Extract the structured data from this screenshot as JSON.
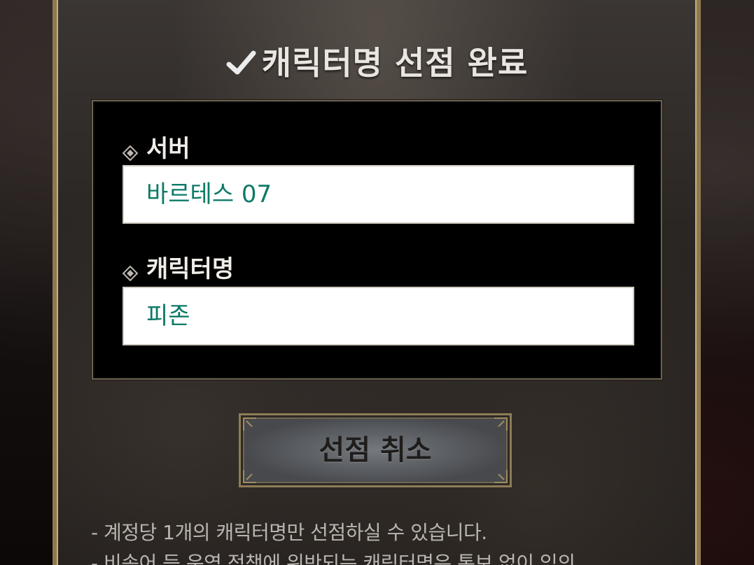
{
  "dialog": {
    "title": "캐릭터명 선점 완료",
    "title_icon": "check-icon"
  },
  "fields": {
    "server": {
      "label": "서버",
      "value": "바르테스 07"
    },
    "character": {
      "label": "캐릭터명",
      "value": "피존"
    }
  },
  "actions": {
    "cancel_label": "선점 취소"
  },
  "notes": [
    "- 계정당 1개의 캐릭터명만 선점하실 수 있습니다.",
    "- 비속어 등 운영 정책에 위반되는 캐릭터명은 통보 없이 임의"
  ],
  "colors": {
    "value_text": "#0d7a67",
    "frame_gold": "#8f7a4f",
    "title_text": "#e9e6e2"
  }
}
